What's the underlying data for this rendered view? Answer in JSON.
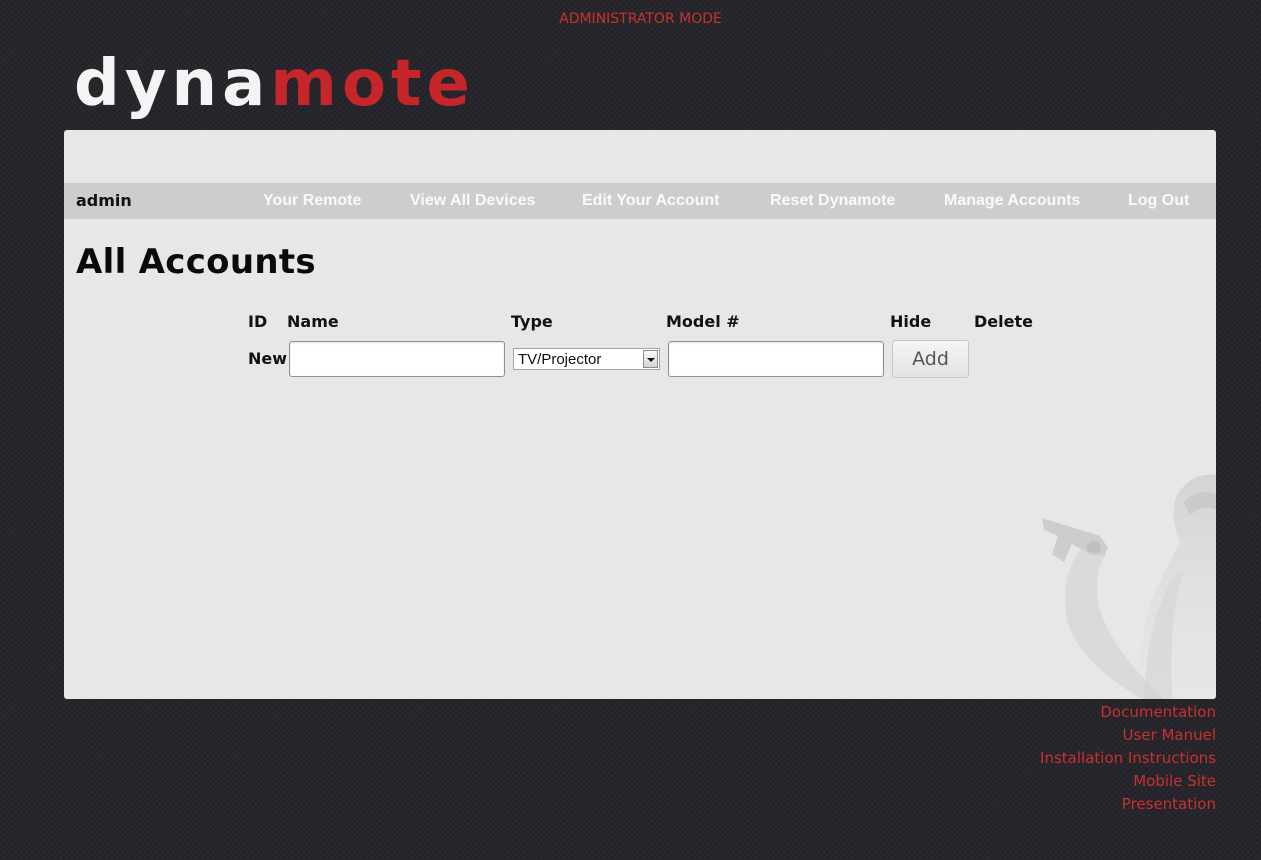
{
  "header": {
    "mode_label": "ADMINISTRATOR MODE"
  },
  "logo": {
    "part1": "dyna",
    "part2": "mote"
  },
  "nav": {
    "user": "admin",
    "links": [
      "Your Remote",
      "View All Devices",
      "Edit Your Account",
      "Reset Dynamote",
      "Manage Accounts",
      "Log Out"
    ]
  },
  "main": {
    "title": "All Accounts",
    "columns": [
      "ID",
      "Name",
      "Type",
      "Model #",
      "Hide",
      "Delete"
    ],
    "new_row": {
      "label": "New",
      "name_value": "",
      "type_selected": "TV/Projector",
      "model_value": "",
      "add_label": "Add"
    }
  },
  "footer": {
    "links": [
      "Documentation",
      "User Manuel",
      "Installation Instructions",
      "Mobile Site",
      "Presentation"
    ]
  },
  "colors": {
    "accent": "#c9312f",
    "logo_red": "#c5262a",
    "page_bg": "#26262c",
    "panel_bg": "#e7e7e7",
    "nav_bg": "#cdcdcd"
  }
}
